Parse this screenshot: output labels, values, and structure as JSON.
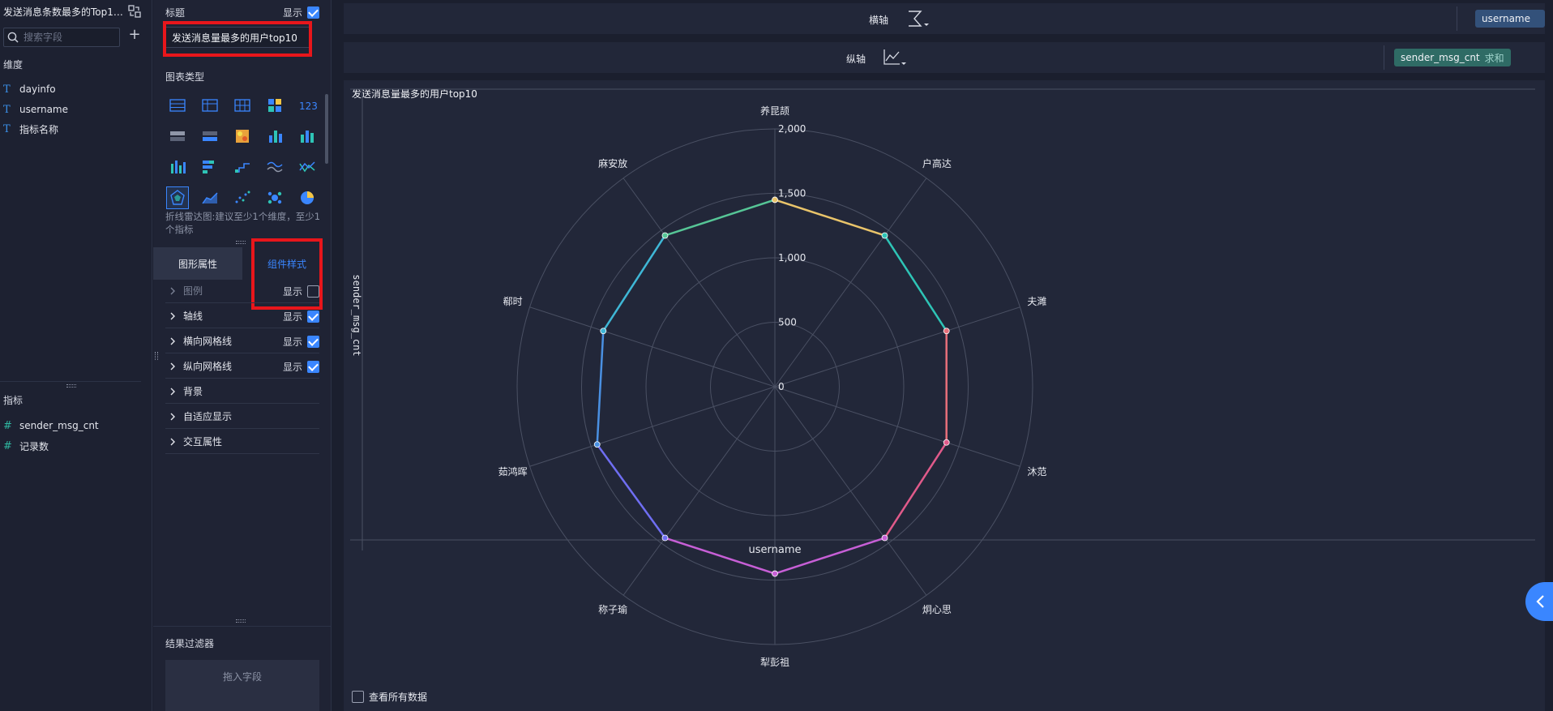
{
  "field_panel": {
    "dataset_title": "发送消息条数最多的Top10...",
    "search_placeholder": "搜索字段",
    "dimensions_label": "维度",
    "dimensions": [
      {
        "name": "dayinfo",
        "type": "text"
      },
      {
        "name": "username",
        "type": "text"
      },
      {
        "name": "指标名称",
        "type": "text"
      }
    ],
    "measures_label": "指标",
    "measures": [
      {
        "name": "sender_msg_cnt",
        "type": "number"
      },
      {
        "name": "记录数",
        "type": "number"
      }
    ]
  },
  "config_panel": {
    "title_label": "标题",
    "title_show_label": "显示",
    "title_show_checked": true,
    "title_value": "发送消息量最多的用户top10",
    "chart_type_label": "图表类型",
    "chart_types": [
      "table-icon",
      "pivot-table-icon",
      "grid-table-icon",
      "color-block-table-icon",
      "kpi-number-icon",
      "ranking-table-icon",
      "detail-table-icon",
      "heatmap-icon",
      "stacked-column-icon",
      "grouped-column-icon",
      "column-icon",
      "stacked-bar-icon",
      "step-line-icon",
      "multi-line-icon",
      "line-icon",
      "radar-icon",
      "area-icon",
      "scatter-icon",
      "bubble-icon",
      "pie-icon"
    ],
    "selected_chart_type": "radar-icon",
    "chart_hint": "折线雷达图:建议至少1个维度，至少1个指标",
    "tabs": [
      "图形属性",
      "组件样式"
    ],
    "active_tab": "组件样式",
    "properties": [
      {
        "label": "图例",
        "show_label": "显示",
        "checked": false,
        "disabled": true
      },
      {
        "label": "轴线",
        "show_label": "显示",
        "checked": true
      },
      {
        "label": "横向网格线",
        "show_label": "显示",
        "checked": true
      },
      {
        "label": "纵向网格线",
        "show_label": "显示",
        "checked": true
      },
      {
        "label": "背景"
      },
      {
        "label": "自适应显示"
      },
      {
        "label": "交互属性"
      }
    ],
    "result_filter_label": "结果过滤器",
    "drop_zone_text": "拖入字段"
  },
  "workspace": {
    "x_axis_label": "横轴",
    "x_axis_field": "username",
    "y_axis_label": "纵轴",
    "y_axis_field": "sender_msg_cnt",
    "y_axis_agg": "求和",
    "view_all_label": "查看所有数据",
    "view_all_checked": false
  },
  "chart_data": {
    "type": "radar",
    "title": "发送消息量最多的用户top10",
    "xlabel": "username",
    "ylabel": "sender_msg_cnt",
    "categories": [
      "养昆颉",
      "户高达",
      "夫濉",
      "沐范",
      "炯心思",
      "犁彭祖",
      "称子瑜",
      "茹鸿晖",
      "郗时",
      "麻安放"
    ],
    "values": [
      1450,
      1450,
      1400,
      1400,
      1450,
      1450,
      1450,
      1450,
      1400,
      1450
    ],
    "ticks": [
      "0",
      "500",
      "1,000",
      "1,500",
      "2,000"
    ],
    "range": [
      0,
      2000
    ],
    "series_colors": [
      "#e9c46a",
      "#2ec4b6",
      "#e76f7a",
      "#e05a8a",
      "#c75fd6",
      "#c75fd6",
      "#6f6ef2",
      "#4a90e2",
      "#3fb7d6",
      "#56c596"
    ]
  }
}
